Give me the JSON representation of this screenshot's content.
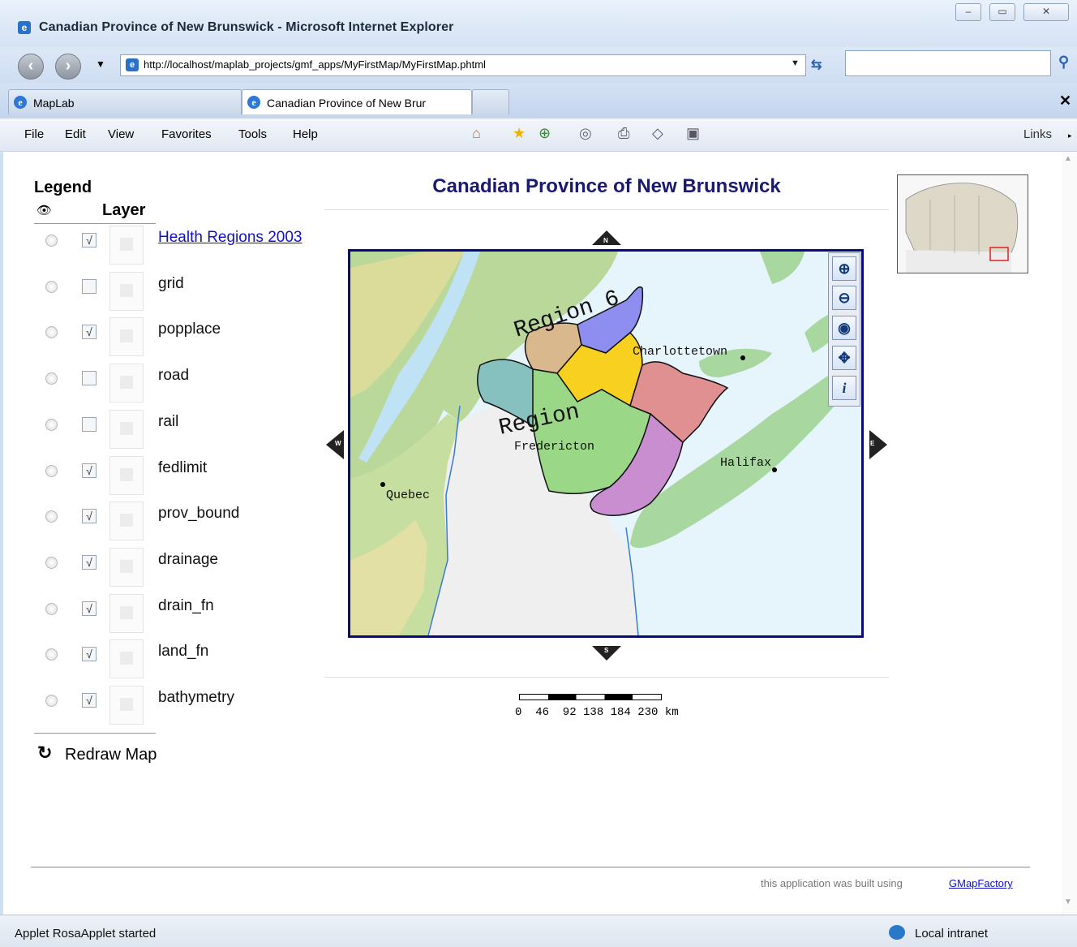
{
  "window": {
    "title": "Canadian Province of New Brunswick - Microsoft Internet Explorer",
    "controls": [
      "–",
      "▭",
      "✕"
    ]
  },
  "address_bar": {
    "url": "http://localhost/maplab_projects/gmf_apps/MyFirstMap/MyFirstMap.phtml",
    "search_placeholder": ""
  },
  "tabs": [
    {
      "label": "MapLab"
    },
    {
      "label": "Canadian Province of New Brur"
    }
  ],
  "menu": {
    "items": [
      "File",
      "Edit",
      "View",
      "Favorites",
      "Tools",
      "Help"
    ],
    "links_label": "Links"
  },
  "legend": {
    "title": "Legend",
    "layer_header": "Layer",
    "layers": [
      {
        "label": "Health Regions 2003",
        "checked": true,
        "link": true
      },
      {
        "label": "grid",
        "checked": false
      },
      {
        "label": "popplace",
        "checked": true
      },
      {
        "label": "road",
        "checked": false
      },
      {
        "label": "rail",
        "checked": false
      },
      {
        "label": "fedlimit",
        "checked": true
      },
      {
        "label": "prov_bound",
        "checked": true
      },
      {
        "label": "drainage",
        "checked": true
      },
      {
        "label": "drain_fn",
        "checked": true
      },
      {
        "label": "land_fn",
        "checked": true
      },
      {
        "label": "bathymetry",
        "checked": true
      }
    ],
    "redraw_label": "Redraw Map"
  },
  "map": {
    "title": "Canadian Province of New Brunswick",
    "labels": {
      "region6": "Region 6",
      "region": "Region",
      "charlottetown": "Charlottetown",
      "fredericton": "Fredericton",
      "halifax": "Halifax",
      "quebec": "Quebec"
    },
    "pan": {
      "n": "N",
      "s": "S",
      "e": "E",
      "w": "W"
    },
    "tools": [
      "zoom-in",
      "zoom-out",
      "zoom-full",
      "pan",
      "info"
    ]
  },
  "scalebar": {
    "labels": "0  46  92 138 184 230 km"
  },
  "footer": {
    "text": "this application was built using",
    "link": "GMapFactory"
  },
  "status": {
    "text": "Applet RosaApplet started",
    "zone": "Local intranet"
  },
  "colors": {
    "region_tan": "#d8b88c",
    "region_blue": "#8e8ef0",
    "region_yellow": "#f8d020",
    "region_teal": "#86c0bf",
    "region_green": "#9ad888",
    "region_red": "#e09090",
    "region_purple": "#c88ed0",
    "water": "#e6f4fb",
    "land_green": "#a8d8a0",
    "us_gray": "#efefef"
  }
}
